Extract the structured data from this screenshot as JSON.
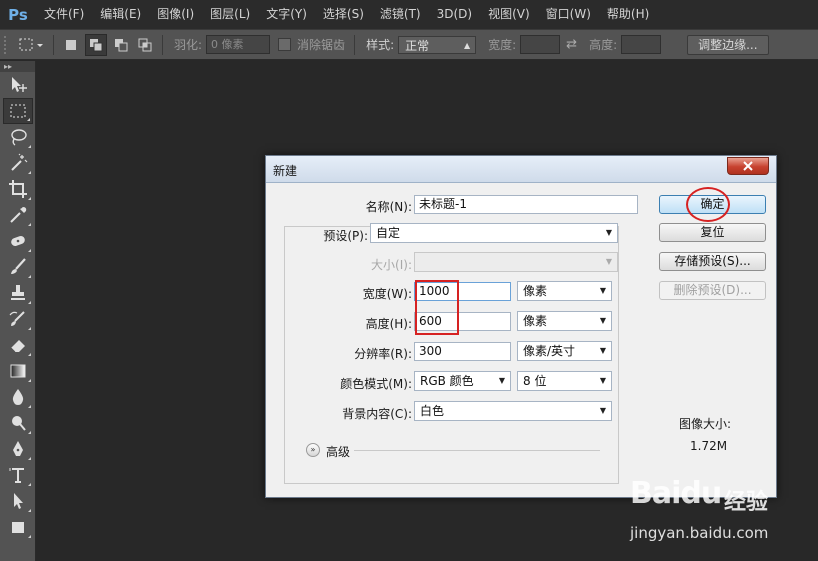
{
  "app": {
    "logo": "Ps",
    "brand_color": "#6fb0e8"
  },
  "menu": [
    "文件(F)",
    "编辑(E)",
    "图像(I)",
    "图层(L)",
    "文字(Y)",
    "选择(S)",
    "滤镜(T)",
    "3D(D)",
    "视图(V)",
    "窗口(W)",
    "帮助(H)"
  ],
  "options": {
    "feather_label": "羽化:",
    "feather_value": "0 像素",
    "antialias_label": "消除锯齿",
    "style_label": "样式:",
    "style_value": "正常",
    "width_label": "宽度:",
    "height_label": "高度:",
    "refine_edge": "调整边缘..."
  },
  "toolbar": {
    "tools": [
      "move-tool",
      "rect-marquee-tool",
      "lasso-tool",
      "magic-wand-tool",
      "crop-tool",
      "eyedropper-tool",
      "spot-healing-tool",
      "brush-tool",
      "clone-stamp-tool",
      "history-brush-tool",
      "eraser-tool",
      "gradient-tool",
      "blur-tool",
      "dodge-tool",
      "pen-tool",
      "type-tool",
      "path-select-tool",
      "shape-tool"
    ]
  },
  "dialog": {
    "title": "新建",
    "name_label": "名称(N):",
    "name_value": "未标题-1",
    "preset_label": "预设(P):",
    "preset_value": "自定",
    "size_label": "大小(I):",
    "width_label": "宽度(W):",
    "width_value": "1000",
    "width_unit": "像素",
    "height_label": "高度(H):",
    "height_value": "600",
    "height_unit": "像素",
    "resolution_label": "分辨率(R):",
    "resolution_value": "300",
    "resolution_unit": "像素/英寸",
    "color_mode_label": "颜色模式(M):",
    "color_mode_value": "RGB 颜色",
    "bit_depth_value": "8 位",
    "background_label": "背景内容(C):",
    "background_value": "白色",
    "advanced_label": "高级",
    "buttons": {
      "ok": "确定",
      "reset": "复位",
      "save_preset": "存储预设(S)...",
      "delete_preset": "删除预设(D)..."
    },
    "image_size_label": "图像大小:",
    "image_size_value": "1.72M"
  },
  "watermark": {
    "logo": "Baidu",
    "cn": "经验",
    "url": "jingyan.baidu.com"
  },
  "colors": {
    "annotation": "#d62222"
  }
}
